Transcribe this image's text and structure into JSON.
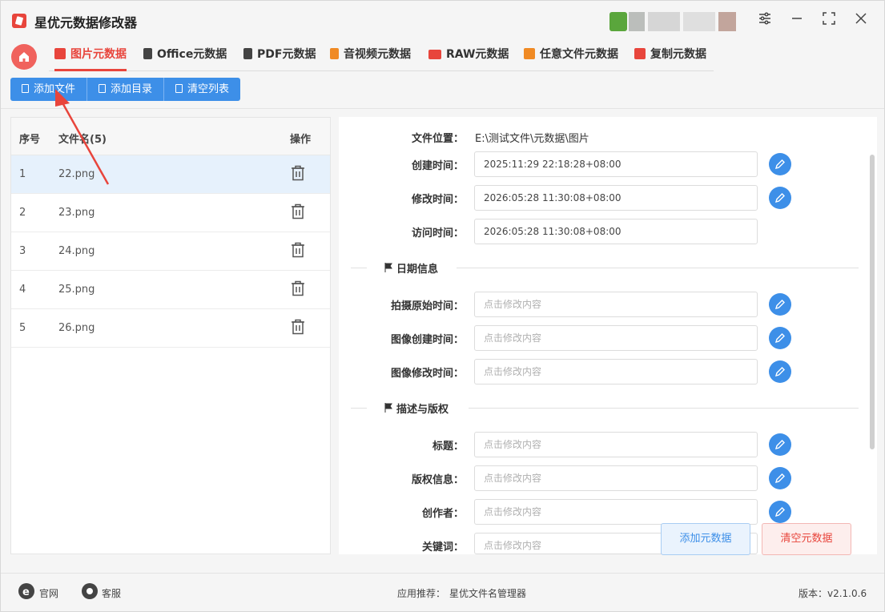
{
  "app": {
    "title": "星优元数据修改器"
  },
  "window_controls": [
    "settings",
    "minimize",
    "maximize",
    "close"
  ],
  "tabs": [
    {
      "label": "图片元数据",
      "active": true,
      "icon": "image-icon",
      "color": "#e8453c"
    },
    {
      "label": "Office元数据",
      "active": false,
      "icon": "office-icon",
      "color": "#444444"
    },
    {
      "label": "PDF元数据",
      "active": false,
      "icon": "pdf-icon",
      "color": "#444444"
    },
    {
      "label": "音视频元数据",
      "active": false,
      "icon": "media-icon",
      "color": "#f08a24"
    },
    {
      "label": "RAW元数据",
      "active": false,
      "icon": "raw-icon",
      "color": "#e8453c"
    },
    {
      "label": "任意文件元数据",
      "active": false,
      "icon": "any-file-icon",
      "color": "#f08a24"
    },
    {
      "label": "复制元数据",
      "active": false,
      "icon": "copy-icon",
      "color": "#e8453c"
    }
  ],
  "toolbar": {
    "add_file": "添加文件",
    "add_dir": "添加目录",
    "clear_list": "清空列表"
  },
  "table": {
    "headers": {
      "index": "序号",
      "filename": "文件名(5)",
      "action": "操作"
    },
    "rows": [
      {
        "index": "1",
        "name": "22.png",
        "selected": true
      },
      {
        "index": "2",
        "name": "23.png",
        "selected": false
      },
      {
        "index": "3",
        "name": "24.png",
        "selected": false
      },
      {
        "index": "4",
        "name": "25.png",
        "selected": false
      },
      {
        "index": "5",
        "name": "26.png",
        "selected": false
      }
    ]
  },
  "details": {
    "file_location_label": "文件位置：",
    "file_location": "E:\\测试文件\\元数据\\图片",
    "created_label": "创建时间：",
    "created": "2025:11:29 22:18:28+08:00",
    "modified_label": "修改时间：",
    "modified": "2026:05:28 11:30:08+08:00",
    "accessed_label": "访问时间：",
    "accessed": "2026:05:28 11:30:08+08:00",
    "date_section": "日期信息",
    "shot_time_label": "拍摄原始时间：",
    "image_created_label": "图像创建时间：",
    "image_modified_label": "图像修改时间：",
    "desc_section": "描述与版权",
    "title_label": "标题：",
    "copyright_label": "版权信息：",
    "creator_label": "创作者：",
    "keywords_label": "关键词：",
    "placeholder": "点击修改内容"
  },
  "actions": {
    "add_metadata": "添加元数据",
    "clear_metadata": "清空元数据"
  },
  "footer": {
    "website": "官网",
    "support": "客服",
    "recommend_label": "应用推荐：",
    "recommend_app": "星优文件名管理器",
    "version": "版本：v2.1.0.6"
  }
}
